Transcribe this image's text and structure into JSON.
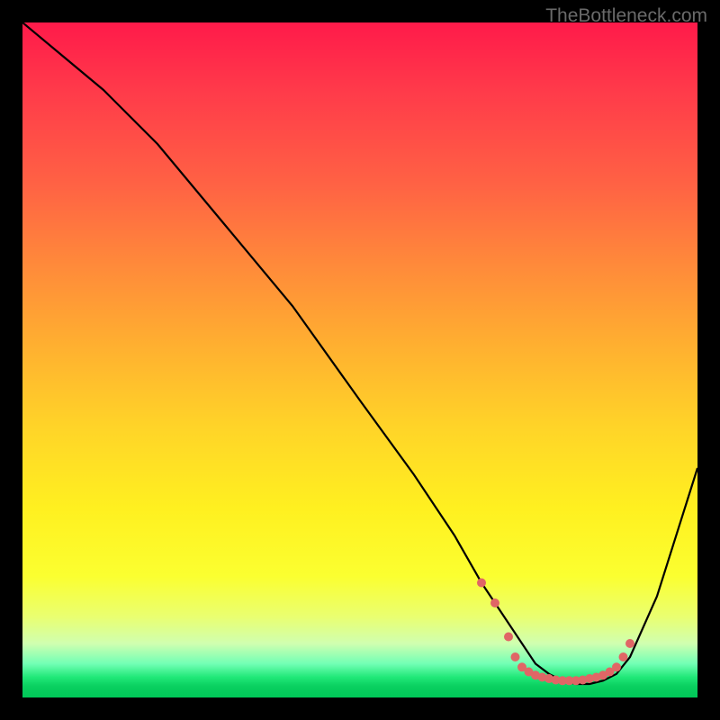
{
  "watermark": "TheBottleneck.com",
  "chart_data": {
    "type": "line",
    "title": "",
    "xlabel": "",
    "ylabel": "",
    "xlim": [
      0,
      100
    ],
    "ylim": [
      0,
      100
    ],
    "series": [
      {
        "name": "bottleneck-curve",
        "x": [
          0,
          6,
          12,
          20,
          30,
          40,
          50,
          58,
          64,
          68,
          70,
          72,
          74,
          76,
          78,
          80,
          82,
          84,
          86,
          88,
          90,
          94,
          100
        ],
        "y": [
          100,
          95,
          90,
          82,
          70,
          58,
          44,
          33,
          24,
          17,
          14,
          11,
          8,
          5,
          3.5,
          2.5,
          2,
          2,
          2.5,
          3.5,
          6,
          15,
          34
        ]
      }
    ],
    "highlight_points": {
      "name": "optimal-range-markers",
      "color": "#e06666",
      "x": [
        68,
        70,
        72,
        73,
        74,
        75,
        76,
        77,
        78,
        79,
        80,
        81,
        82,
        83,
        84,
        85,
        86,
        87,
        88,
        89,
        90
      ],
      "y": [
        17,
        14,
        9,
        6,
        4.5,
        3.8,
        3.3,
        3.0,
        2.8,
        2.6,
        2.5,
        2.5,
        2.5,
        2.6,
        2.8,
        3.0,
        3.3,
        3.8,
        4.5,
        6,
        8
      ]
    },
    "background_gradient": {
      "stops": [
        {
          "pos": 0.0,
          "color": "#ff1a4a"
        },
        {
          "pos": 0.5,
          "color": "#ffc028"
        },
        {
          "pos": 0.82,
          "color": "#fbff30"
        },
        {
          "pos": 0.95,
          "color": "#72ffb5"
        },
        {
          "pos": 1.0,
          "color": "#00c858"
        }
      ]
    }
  }
}
